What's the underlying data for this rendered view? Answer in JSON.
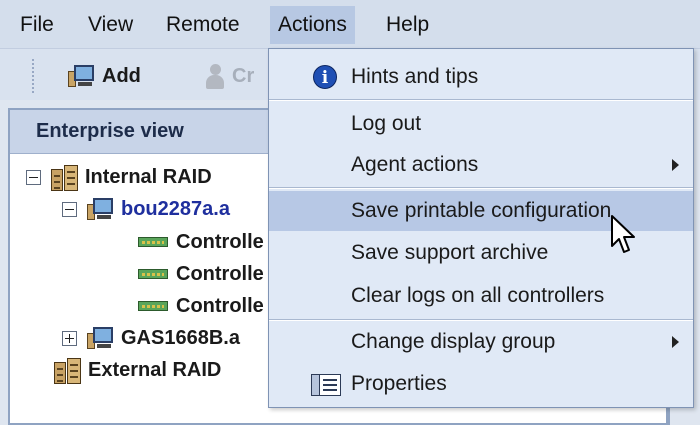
{
  "menubar": {
    "items": [
      {
        "label": "File"
      },
      {
        "label": "View"
      },
      {
        "label": "Remote"
      },
      {
        "label": "Actions"
      },
      {
        "label": "Help"
      }
    ]
  },
  "toolbar": {
    "add_label": "Add",
    "create_label": "Cr"
  },
  "panel": {
    "title": "Enterprise view",
    "tree": [
      {
        "label": "Internal RAID"
      },
      {
        "label": "bou2287a.a"
      },
      {
        "label": "Controlle"
      },
      {
        "label": "Controlle"
      },
      {
        "label": "Controlle"
      },
      {
        "label": "GAS1668B.a"
      },
      {
        "label": "External RAID"
      }
    ]
  },
  "actions_menu": {
    "items": [
      {
        "label": "Hints and tips"
      },
      {
        "label": "Log out"
      },
      {
        "label": "Agent actions"
      },
      {
        "label": "Save printable configuration"
      },
      {
        "label": "Save support archive"
      },
      {
        "label": "Clear logs on all controllers"
      },
      {
        "label": "Change display group"
      },
      {
        "label": "Properties"
      }
    ]
  },
  "colors": {
    "menu_bg": "#e0e9f6",
    "highlight": "#b7c8e5",
    "selected_host_text": "#1f2f9e"
  }
}
